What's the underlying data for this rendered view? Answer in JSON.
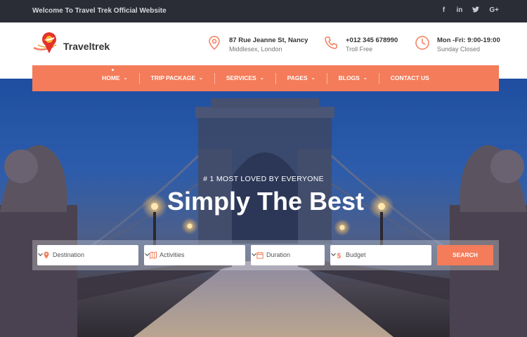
{
  "topbar": {
    "welcome": "Welcome To Travel Trek Official Website",
    "social": [
      {
        "icon": "facebook-icon",
        "glyph": "f"
      },
      {
        "icon": "linkedin-icon",
        "glyph": "in"
      },
      {
        "icon": "twitter-icon",
        "glyph": "🐦"
      },
      {
        "icon": "google-plus-icon",
        "glyph": "G+"
      }
    ]
  },
  "header": {
    "logo_text": "Traveltrek",
    "address": {
      "line1": "87 Rue Jeanne St, Nancy",
      "line2": "Middlesex, London",
      "icon": "location-pin-icon"
    },
    "phone": {
      "line1": "+012 345 678990",
      "line2": "Troll Free",
      "icon": "phone-icon"
    },
    "hours": {
      "line1": "Mon -Fri: 9:00-19:00",
      "line2": "Sunday Closed",
      "icon": "clock-icon"
    }
  },
  "nav": {
    "items": [
      {
        "label": "HOME",
        "active": true
      },
      {
        "label": "TRIP PACKAGE"
      },
      {
        "label": "SERVICES"
      },
      {
        "label": "PAGES"
      },
      {
        "label": "BLOGS"
      },
      {
        "label": "CONTACT US"
      }
    ]
  },
  "hero": {
    "eyebrow": "# 1 MOST LOVED BY EVERYONE",
    "headline": "Simply The Best"
  },
  "search": {
    "destination": "Destination",
    "activities": "Activities",
    "duration": "Duration",
    "budget": "Budget",
    "button": "SEARCH"
  },
  "colors": {
    "accent": "#f47c5a",
    "topbar": "#2a2d36"
  }
}
